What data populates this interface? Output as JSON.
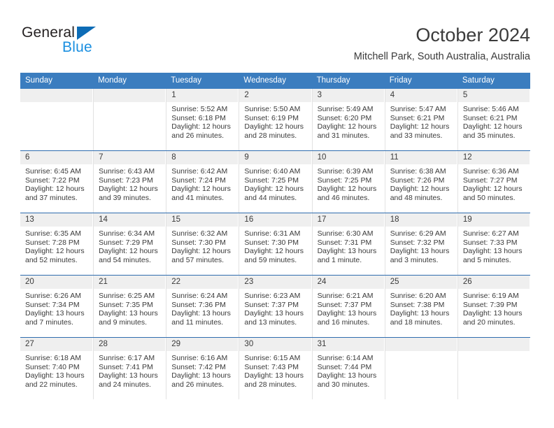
{
  "brand": {
    "name_part1": "General",
    "name_part2": "Blue",
    "triangle_color": "#0d6cb6",
    "blue_color": "#1a8fe0"
  },
  "header": {
    "title": "October 2024",
    "location": "Mitchell Park, South Australia, Australia"
  },
  "theme": {
    "header_blue": "#3b7dbf",
    "row_border": "#2f6daf",
    "daynum_band": "#efefef"
  },
  "weekdays": [
    "Sunday",
    "Monday",
    "Tuesday",
    "Wednesday",
    "Thursday",
    "Friday",
    "Saturday"
  ],
  "weeks": [
    [
      {
        "day": "",
        "sunrise": "",
        "sunset": "",
        "daylight1": "",
        "daylight2": ""
      },
      {
        "day": "",
        "sunrise": "",
        "sunset": "",
        "daylight1": "",
        "daylight2": ""
      },
      {
        "day": "1",
        "sunrise": "Sunrise: 5:52 AM",
        "sunset": "Sunset: 6:18 PM",
        "daylight1": "Daylight: 12 hours",
        "daylight2": "and 26 minutes."
      },
      {
        "day": "2",
        "sunrise": "Sunrise: 5:50 AM",
        "sunset": "Sunset: 6:19 PM",
        "daylight1": "Daylight: 12 hours",
        "daylight2": "and 28 minutes."
      },
      {
        "day": "3",
        "sunrise": "Sunrise: 5:49 AM",
        "sunset": "Sunset: 6:20 PM",
        "daylight1": "Daylight: 12 hours",
        "daylight2": "and 31 minutes."
      },
      {
        "day": "4",
        "sunrise": "Sunrise: 5:47 AM",
        "sunset": "Sunset: 6:21 PM",
        "daylight1": "Daylight: 12 hours",
        "daylight2": "and 33 minutes."
      },
      {
        "day": "5",
        "sunrise": "Sunrise: 5:46 AM",
        "sunset": "Sunset: 6:21 PM",
        "daylight1": "Daylight: 12 hours",
        "daylight2": "and 35 minutes."
      }
    ],
    [
      {
        "day": "6",
        "sunrise": "Sunrise: 6:45 AM",
        "sunset": "Sunset: 7:22 PM",
        "daylight1": "Daylight: 12 hours",
        "daylight2": "and 37 minutes."
      },
      {
        "day": "7",
        "sunrise": "Sunrise: 6:43 AM",
        "sunset": "Sunset: 7:23 PM",
        "daylight1": "Daylight: 12 hours",
        "daylight2": "and 39 minutes."
      },
      {
        "day": "8",
        "sunrise": "Sunrise: 6:42 AM",
        "sunset": "Sunset: 7:24 PM",
        "daylight1": "Daylight: 12 hours",
        "daylight2": "and 41 minutes."
      },
      {
        "day": "9",
        "sunrise": "Sunrise: 6:40 AM",
        "sunset": "Sunset: 7:25 PM",
        "daylight1": "Daylight: 12 hours",
        "daylight2": "and 44 minutes."
      },
      {
        "day": "10",
        "sunrise": "Sunrise: 6:39 AM",
        "sunset": "Sunset: 7:25 PM",
        "daylight1": "Daylight: 12 hours",
        "daylight2": "and 46 minutes."
      },
      {
        "day": "11",
        "sunrise": "Sunrise: 6:38 AM",
        "sunset": "Sunset: 7:26 PM",
        "daylight1": "Daylight: 12 hours",
        "daylight2": "and 48 minutes."
      },
      {
        "day": "12",
        "sunrise": "Sunrise: 6:36 AM",
        "sunset": "Sunset: 7:27 PM",
        "daylight1": "Daylight: 12 hours",
        "daylight2": "and 50 minutes."
      }
    ],
    [
      {
        "day": "13",
        "sunrise": "Sunrise: 6:35 AM",
        "sunset": "Sunset: 7:28 PM",
        "daylight1": "Daylight: 12 hours",
        "daylight2": "and 52 minutes."
      },
      {
        "day": "14",
        "sunrise": "Sunrise: 6:34 AM",
        "sunset": "Sunset: 7:29 PM",
        "daylight1": "Daylight: 12 hours",
        "daylight2": "and 54 minutes."
      },
      {
        "day": "15",
        "sunrise": "Sunrise: 6:32 AM",
        "sunset": "Sunset: 7:30 PM",
        "daylight1": "Daylight: 12 hours",
        "daylight2": "and 57 minutes."
      },
      {
        "day": "16",
        "sunrise": "Sunrise: 6:31 AM",
        "sunset": "Sunset: 7:30 PM",
        "daylight1": "Daylight: 12 hours",
        "daylight2": "and 59 minutes."
      },
      {
        "day": "17",
        "sunrise": "Sunrise: 6:30 AM",
        "sunset": "Sunset: 7:31 PM",
        "daylight1": "Daylight: 13 hours",
        "daylight2": "and 1 minute."
      },
      {
        "day": "18",
        "sunrise": "Sunrise: 6:29 AM",
        "sunset": "Sunset: 7:32 PM",
        "daylight1": "Daylight: 13 hours",
        "daylight2": "and 3 minutes."
      },
      {
        "day": "19",
        "sunrise": "Sunrise: 6:27 AM",
        "sunset": "Sunset: 7:33 PM",
        "daylight1": "Daylight: 13 hours",
        "daylight2": "and 5 minutes."
      }
    ],
    [
      {
        "day": "20",
        "sunrise": "Sunrise: 6:26 AM",
        "sunset": "Sunset: 7:34 PM",
        "daylight1": "Daylight: 13 hours",
        "daylight2": "and 7 minutes."
      },
      {
        "day": "21",
        "sunrise": "Sunrise: 6:25 AM",
        "sunset": "Sunset: 7:35 PM",
        "daylight1": "Daylight: 13 hours",
        "daylight2": "and 9 minutes."
      },
      {
        "day": "22",
        "sunrise": "Sunrise: 6:24 AM",
        "sunset": "Sunset: 7:36 PM",
        "daylight1": "Daylight: 13 hours",
        "daylight2": "and 11 minutes."
      },
      {
        "day": "23",
        "sunrise": "Sunrise: 6:23 AM",
        "sunset": "Sunset: 7:37 PM",
        "daylight1": "Daylight: 13 hours",
        "daylight2": "and 13 minutes."
      },
      {
        "day": "24",
        "sunrise": "Sunrise: 6:21 AM",
        "sunset": "Sunset: 7:37 PM",
        "daylight1": "Daylight: 13 hours",
        "daylight2": "and 16 minutes."
      },
      {
        "day": "25",
        "sunrise": "Sunrise: 6:20 AM",
        "sunset": "Sunset: 7:38 PM",
        "daylight1": "Daylight: 13 hours",
        "daylight2": "and 18 minutes."
      },
      {
        "day": "26",
        "sunrise": "Sunrise: 6:19 AM",
        "sunset": "Sunset: 7:39 PM",
        "daylight1": "Daylight: 13 hours",
        "daylight2": "and 20 minutes."
      }
    ],
    [
      {
        "day": "27",
        "sunrise": "Sunrise: 6:18 AM",
        "sunset": "Sunset: 7:40 PM",
        "daylight1": "Daylight: 13 hours",
        "daylight2": "and 22 minutes."
      },
      {
        "day": "28",
        "sunrise": "Sunrise: 6:17 AM",
        "sunset": "Sunset: 7:41 PM",
        "daylight1": "Daylight: 13 hours",
        "daylight2": "and 24 minutes."
      },
      {
        "day": "29",
        "sunrise": "Sunrise: 6:16 AM",
        "sunset": "Sunset: 7:42 PM",
        "daylight1": "Daylight: 13 hours",
        "daylight2": "and 26 minutes."
      },
      {
        "day": "30",
        "sunrise": "Sunrise: 6:15 AM",
        "sunset": "Sunset: 7:43 PM",
        "daylight1": "Daylight: 13 hours",
        "daylight2": "and 28 minutes."
      },
      {
        "day": "31",
        "sunrise": "Sunrise: 6:14 AM",
        "sunset": "Sunset: 7:44 PM",
        "daylight1": "Daylight: 13 hours",
        "daylight2": "and 30 minutes."
      },
      {
        "day": "",
        "sunrise": "",
        "sunset": "",
        "daylight1": "",
        "daylight2": ""
      },
      {
        "day": "",
        "sunrise": "",
        "sunset": "",
        "daylight1": "",
        "daylight2": ""
      }
    ]
  ]
}
